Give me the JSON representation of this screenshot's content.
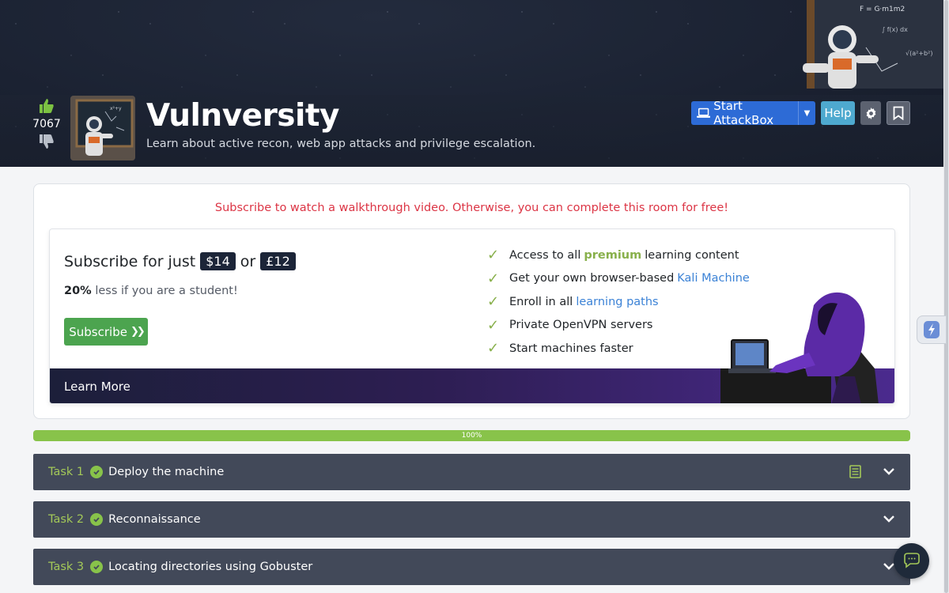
{
  "room": {
    "title": "Vulnversity",
    "description": "Learn about active recon, web app attacks and privilege escalation.",
    "votes": "7067"
  },
  "actions": {
    "attackbox_label": "Start AttackBox",
    "help_label": "Help"
  },
  "subscribe": {
    "notice": "Subscribe to watch a walkthrough video. Otherwise, you can complete this room for free!",
    "price_prefix": "Subscribe for just",
    "price_usd": "$14",
    "price_or": "or",
    "price_gbp": "£12",
    "student_pct": "20%",
    "student_text": "less if you are a student!",
    "button_label": "Subscribe",
    "learn_more": "Learn More",
    "features": [
      {
        "pre": "Access to all",
        "hl": "premium",
        "post": "learning content"
      },
      {
        "pre": "Get your own browser-based",
        "hl": "Kali Machine",
        "post": ""
      },
      {
        "pre": "Enroll in all",
        "hl": "learning paths",
        "post": ""
      },
      {
        "pre": "Private OpenVPN servers",
        "hl": "",
        "post": ""
      },
      {
        "pre": "Start machines faster",
        "hl": "",
        "post": ""
      }
    ]
  },
  "progress": {
    "label": "100%",
    "value": 1.0
  },
  "tasks": [
    {
      "number": "Task 1",
      "title": "Deploy the machine"
    },
    {
      "number": "Task 2",
      "title": "Reconnaissance"
    },
    {
      "number": "Task 3",
      "title": "Locating directories using Gobuster"
    }
  ],
  "colors": {
    "accent_blue": "#2d6bd6",
    "success_green": "#88c34a",
    "notice_red": "#dc3545",
    "task_bg": "#424959"
  }
}
